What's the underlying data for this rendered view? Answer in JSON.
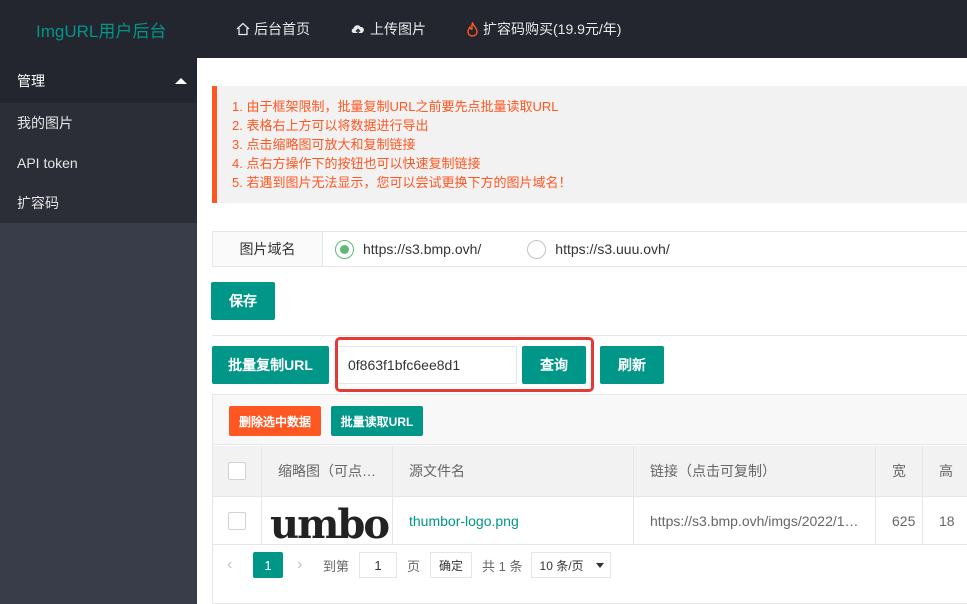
{
  "header": {
    "logo": "ImgURL用户后台",
    "nav": [
      {
        "icon": "home-icon",
        "label": "后台首页"
      },
      {
        "icon": "cloud-upload-icon",
        "label": "上传图片"
      },
      {
        "icon": "fire-icon",
        "label": "扩容码购买(19.9元/年)"
      }
    ]
  },
  "sidebar": {
    "group": "管理",
    "items": [
      {
        "label": "我的图片"
      },
      {
        "label": "API token"
      },
      {
        "label": "扩容码"
      }
    ]
  },
  "notice": {
    "lines": [
      "1. 由于框架限制，批量复制URL之前要先点批量读取URL",
      "2. 表格右上方可以将数据进行导出",
      "3. 点击缩略图可放大和复制链接",
      "4. 点右方操作下的按钮也可以快速复制链接",
      "5. 若遇到图片无法显示，您可以尝试更换下方的图片域名！"
    ]
  },
  "domain": {
    "label": "图片域名",
    "options": [
      {
        "label": "https://s3.bmp.ovh/",
        "checked": true
      },
      {
        "label": "https://s3.uuu.ovh/",
        "checked": false
      }
    ]
  },
  "actions": {
    "save": "保存",
    "batch_copy": "批量复制URL",
    "search_value": "0f863f1bfc6ee8d1",
    "query": "查询",
    "refresh": "刷新"
  },
  "table": {
    "toolbar": {
      "delete": "删除选中数据",
      "batch_read": "批量读取URL"
    },
    "headers": [
      "缩略图（可点…",
      "源文件名",
      "链接（点击可复制）",
      "宽",
      "高"
    ],
    "rows": [
      {
        "thumb_text": "umbo",
        "filename": "thumbor-logo.png",
        "link": "https://s3.bmp.ovh/imgs/2022/1…",
        "width": "625",
        "height": "18"
      }
    ],
    "pager": {
      "current": "1",
      "goto_label": "到第",
      "goto_value": "1",
      "page_label": "页",
      "confirm": "确定",
      "total": "共 1 条",
      "per_page": "10 条/页"
    }
  },
  "colors": {
    "accent": "#009688",
    "warning": "#ff5722",
    "header_bg": "#23262e",
    "sidebar_bg": "#393d49",
    "highlight": "#e53935"
  }
}
